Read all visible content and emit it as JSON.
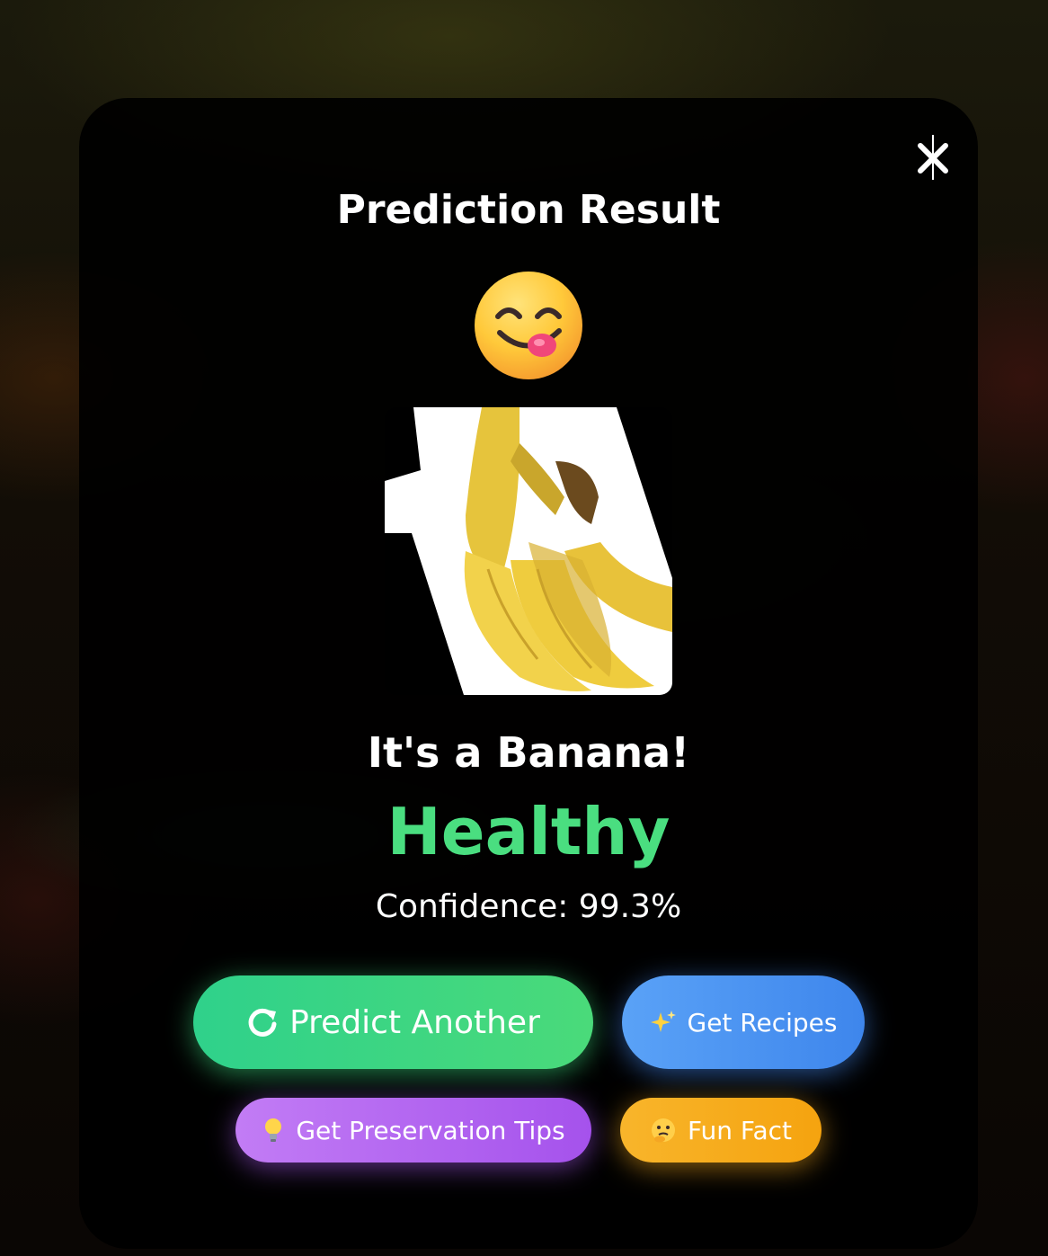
{
  "modal": {
    "title": "Prediction Result",
    "emoji_icon": "face-savoring-food-icon",
    "image_icon": "banana-photo",
    "result_text": "It's a Banana!",
    "status_text": "Healthy",
    "status_color": "#4ade80",
    "confidence_text": "Confidence: 99.3%",
    "close_icon": "close-icon"
  },
  "buttons": {
    "predict_another": {
      "label": "Predict Another",
      "icon": "refresh-icon",
      "color": "#3cd684"
    },
    "get_recipes": {
      "label": "Get Recipes",
      "icon": "sparkles-icon",
      "color": "#4a93f2"
    },
    "preservation_tips": {
      "label": "Get Preservation Tips",
      "icon": "lightbulb-icon",
      "color": "#b266f0"
    },
    "fun_fact": {
      "label": "Fun Fact",
      "icon": "thinking-face-icon",
      "color": "#f7ad1e"
    }
  }
}
